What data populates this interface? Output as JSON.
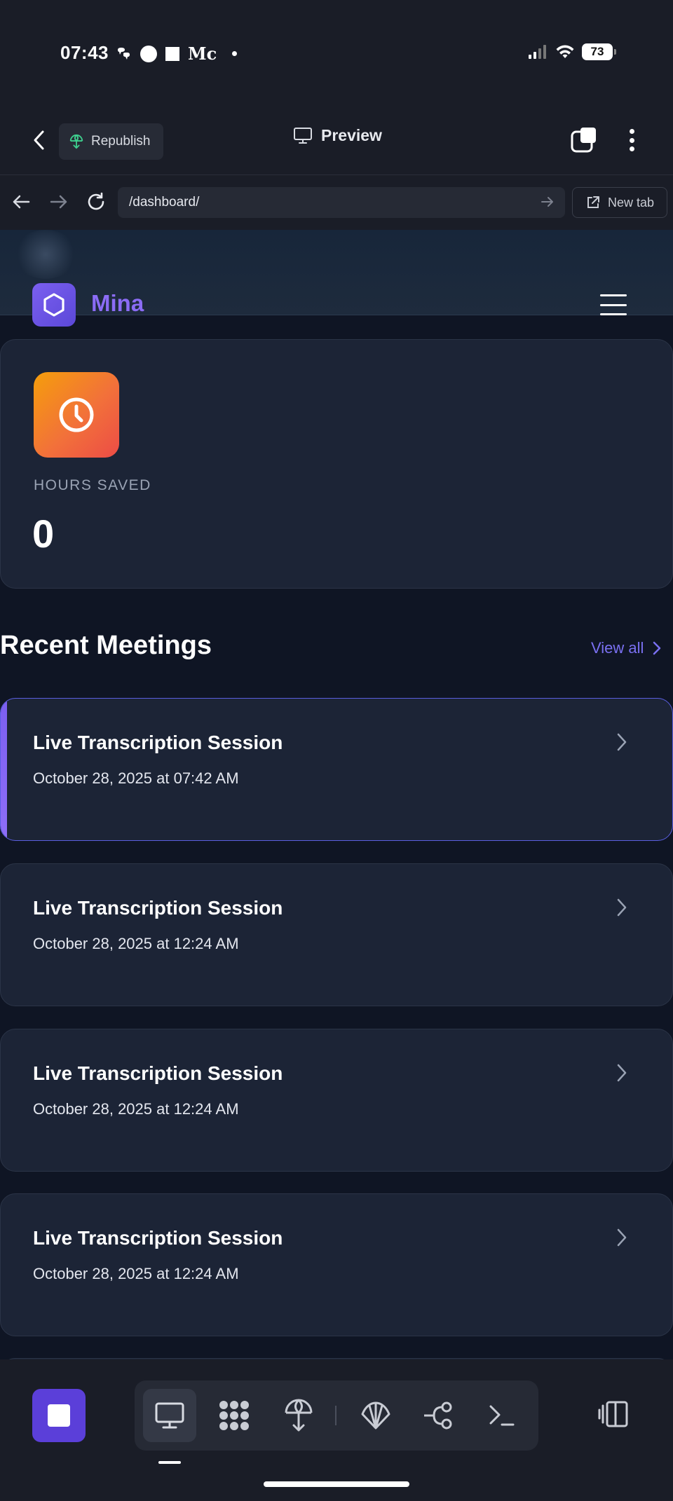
{
  "status_bar": {
    "time": "07:43",
    "m_glyph": "Mc",
    "battery": "73",
    "icons": [
      "thread-icon",
      "circle-icon",
      "square-icon",
      "medium-icon",
      "dot-icon",
      "signal-icon",
      "wifi-icon",
      "battery-icon"
    ]
  },
  "toolbar": {
    "republish_label": "Republish",
    "preview_label": "Preview"
  },
  "urlbar": {
    "url": "/dashboard/",
    "new_tab_label": "New tab"
  },
  "site": {
    "brand": "Mina",
    "stat": {
      "label": "HOURS SAVED",
      "value": "0"
    },
    "section_title": "Recent Meetings",
    "view_all": "View all",
    "meetings": [
      {
        "title": "Live Transcription Session",
        "date": "October 28, 2025 at 07:42 AM"
      },
      {
        "title": "Live Transcription Session",
        "date": "October 28, 2025 at 12:24 AM"
      },
      {
        "title": "Live Transcription Session",
        "date": "October 28, 2025 at 12:24 AM"
      },
      {
        "title": "Live Transcription Session",
        "date": "October 28, 2025 at 12:24 AM"
      }
    ]
  },
  "colors": {
    "accent": "#7b5ff0",
    "brand_text": "#8b6cf5",
    "link": "#7a70f2",
    "stat_icon_gradient": [
      "#f59e0b",
      "#ec4c46"
    ],
    "background": "#0f1524",
    "card": "#1c2436"
  },
  "dock": {
    "items": [
      "desktop-icon",
      "apps-icon",
      "deploy-icon",
      "shell-icon",
      "branch-icon",
      "terminal-icon"
    ]
  }
}
